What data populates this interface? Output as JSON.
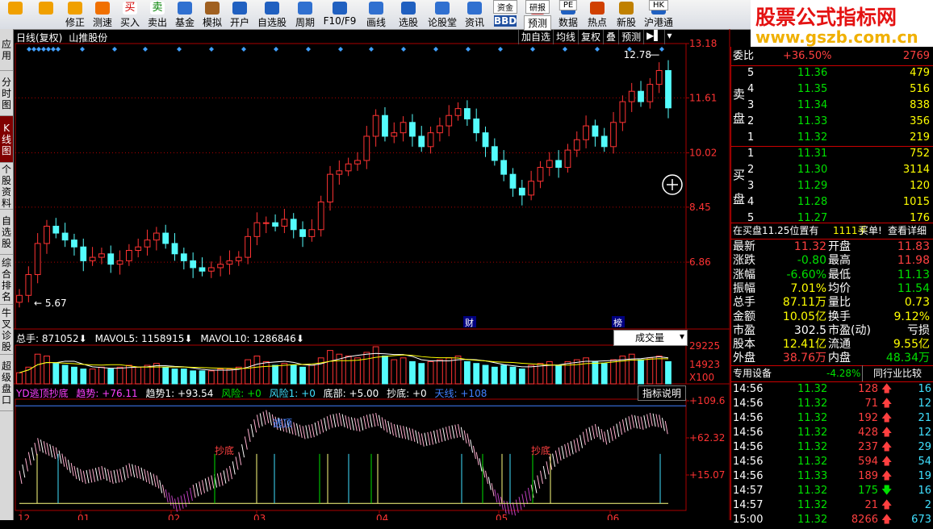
{
  "toolbar": {
    "items": [
      {
        "label": "",
        "icon": "left-arrow-icon"
      },
      {
        "label": "",
        "icon": "right-arrow-icon"
      },
      {
        "label": "修正",
        "icon": "undo-icon"
      },
      {
        "label": "测速",
        "icon": "clock-icon"
      },
      {
        "label": "买入",
        "icon": "buy-icon",
        "glyph": "买"
      },
      {
        "label": "卖出",
        "icon": "sell-icon",
        "glyph": "卖"
      },
      {
        "label": "基金",
        "icon": "fund-icon"
      },
      {
        "label": "模拟",
        "icon": "simulate-icon"
      },
      {
        "label": "开户",
        "icon": "account-icon"
      },
      {
        "label": "自选股",
        "icon": "star-icon"
      },
      {
        "label": "周期",
        "icon": "calendar-icon"
      },
      {
        "label": "F10/F9",
        "icon": "f10-icon"
      },
      {
        "label": "画线",
        "icon": "pen-icon"
      },
      {
        "label": "选股",
        "icon": "filter-icon"
      },
      {
        "label": "论股堂",
        "icon": "forum-icon"
      },
      {
        "label": "资讯",
        "icon": "news-icon"
      },
      {
        "label": "BBD",
        "icon": "bbd-icon",
        "top": "资金"
      },
      {
        "label": "预测",
        "icon": "forecast-icon",
        "top": "研报"
      },
      {
        "label": "数据",
        "icon": "data-icon",
        "top": "PE"
      },
      {
        "label": "热点",
        "icon": "hot-icon"
      },
      {
        "label": "新股",
        "icon": "ipo-icon"
      },
      {
        "label": "沪港通",
        "icon": "hk-icon",
        "top": "HK"
      }
    ]
  },
  "logo": {
    "line1": "股票公式指标网",
    "line2": "www.gszb.com.cn"
  },
  "left_tabs": [
    {
      "label": "应用",
      "active": false
    },
    {
      "label": "分时图",
      "active": false
    },
    {
      "label": "K线图",
      "active": true
    },
    {
      "label": "个股资料",
      "active": false
    },
    {
      "label": "自选股",
      "active": false
    },
    {
      "label": "综合排名",
      "active": false
    },
    {
      "label": "牛叉诊股",
      "active": false
    },
    {
      "label": "超级盘口",
      "active": false
    }
  ],
  "chart_header": {
    "mode": "日线(复权)",
    "stock": "山推股份"
  },
  "chart_buttons": [
    "加自选",
    "均线",
    "复权",
    "叠",
    "预测",
    "▶▌",
    "▾"
  ],
  "price_labels": [
    "13.18",
    "11.61",
    "10.02",
    "8.45",
    "6.86"
  ],
  "high_label": "12.78",
  "low_label": "5.67",
  "event_labels": [
    {
      "text": "财"
    },
    {
      "text": "榜"
    }
  ],
  "volume_header": {
    "total": "总手: 871052",
    "ma5": "MAVOL5: 1158915",
    "ma10": "MAVOL10: 1286846",
    "selector": "成交量"
  },
  "volume_labels": [
    "29225",
    "14923",
    "X100"
  ],
  "indicator_header": {
    "name": "YD逃顶抄底",
    "trend": "趋势: +76.11",
    "trend1": "趋势1: +93.54",
    "risk": "风险: +0",
    "risk1": "风险1: +0",
    "bottom": "底部: +5.00",
    "chaodi": "抄底: +0",
    "tianxian": "天线: +108",
    "help": "指标说明"
  },
  "indicator_labels": [
    "+109.6",
    "+62.32",
    "+15.07"
  ],
  "indicator_marks": [
    {
      "text": "逃顶"
    },
    {
      "text": "抄底"
    },
    {
      "text": "抄底"
    }
  ],
  "date_labels": [
    "12",
    "01",
    "02",
    "03",
    "04",
    "05",
    "06"
  ],
  "right_panel": {
    "weibi": {
      "label": "委比",
      "pct": "+36.50%",
      "value": "2769"
    },
    "sell_label": "卖盘",
    "buy_label": "买盘",
    "sell": [
      {
        "n": "5",
        "price": "11.36",
        "vol": "479"
      },
      {
        "n": "4",
        "price": "11.35",
        "vol": "516"
      },
      {
        "n": "3",
        "price": "11.34",
        "vol": "838"
      },
      {
        "n": "2",
        "price": "11.33",
        "vol": "356"
      },
      {
        "n": "1",
        "price": "11.32",
        "vol": "219"
      }
    ],
    "buy": [
      {
        "n": "1",
        "price": "11.31",
        "vol": "752"
      },
      {
        "n": "2",
        "price": "11.30",
        "vol": "3114"
      },
      {
        "n": "3",
        "price": "11.29",
        "vol": "120"
      },
      {
        "n": "4",
        "price": "11.28",
        "vol": "1015"
      },
      {
        "n": "5",
        "price": "11.27",
        "vol": "176"
      }
    ],
    "notice": {
      "text": "在买盘11.25位置有",
      "vol": "1111手",
      "action": "买单!",
      "detail": "查看详细"
    },
    "stats": [
      {
        "l1": "最新",
        "v1": "11.32",
        "c1": "red",
        "l2": "开盘",
        "v2": "11.83",
        "c2": "red"
      },
      {
        "l1": "涨跌",
        "v1": "-0.80",
        "c1": "green",
        "l2": "最高",
        "v2": "11.98",
        "c2": "red"
      },
      {
        "l1": "涨幅",
        "v1": "-6.60%",
        "c1": "green",
        "l2": "最低",
        "v2": "11.13",
        "c2": "green"
      },
      {
        "l1": "振幅",
        "v1": "7.01%",
        "c1": "yel",
        "l2": "均价",
        "v2": "11.54",
        "c2": "green"
      },
      {
        "l1": "总手",
        "v1": "87.11万",
        "c1": "yel",
        "l2": "量比",
        "v2": "0.73",
        "c2": "yel"
      },
      {
        "l1": "金额",
        "v1": "10.05亿",
        "c1": "yel",
        "l2": "换手",
        "v2": "9.12%",
        "c2": "yel"
      },
      {
        "l1": "市盈",
        "v1": "302.5",
        "c1": "wht",
        "l2": "市盈(动)",
        "v2": "亏损",
        "c2": "wht"
      },
      {
        "l1": "股本",
        "v1": "12.41亿",
        "c1": "yel",
        "l2": "流通",
        "v2": "9.55亿",
        "c2": "yel"
      },
      {
        "l1": "外盘",
        "v1": "38.76万",
        "c1": "red",
        "l2": "内盘",
        "v2": "48.34万",
        "c2": "green"
      }
    ],
    "sector": {
      "name": "专用设备",
      "pct": "-4.28%",
      "compare": "同行业比较"
    },
    "ticks": [
      {
        "time": "14:56",
        "price": "11.32",
        "vol": "128",
        "dir": "up",
        "n": "16"
      },
      {
        "time": "14:56",
        "price": "11.32",
        "vol": "71",
        "dir": "up",
        "n": "12"
      },
      {
        "time": "14:56",
        "price": "11.32",
        "vol": "192",
        "dir": "up",
        "n": "21"
      },
      {
        "time": "14:56",
        "price": "11.32",
        "vol": "428",
        "dir": "up",
        "n": "12"
      },
      {
        "time": "14:56",
        "price": "11.32",
        "vol": "237",
        "dir": "up",
        "n": "29"
      },
      {
        "time": "14:56",
        "price": "11.32",
        "vol": "594",
        "dir": "up",
        "n": "54"
      },
      {
        "time": "14:56",
        "price": "11.33",
        "vol": "189",
        "dir": "up",
        "n": "19"
      },
      {
        "time": "14:57",
        "price": "11.32",
        "vol": "175",
        "dir": "down",
        "n": "16"
      },
      {
        "time": "14:57",
        "price": "11.32",
        "vol": "21",
        "dir": "up",
        "n": "2"
      },
      {
        "time": "15:00",
        "price": "11.32",
        "vol": "8266",
        "dir": "up",
        "n": "673"
      }
    ]
  },
  "colors": {
    "up": "#ff3333",
    "down": "#54fcfc",
    "axis": "#aa0000",
    "ma5": "#ffffff",
    "ma10": "#ffff00"
  },
  "chart_data": {
    "type": "candlestick",
    "title": "山推股份 日线(复权)",
    "ylim": [
      5.3,
      13.18
    ],
    "dates": [
      "12",
      "01",
      "02",
      "03",
      "04",
      "05",
      "06"
    ],
    "close": [
      5.9,
      6.5,
      7.4,
      7.9,
      7.7,
      7.5,
      7.3,
      6.9,
      7.0,
      7.1,
      6.8,
      6.9,
      7.2,
      7.3,
      7.5,
      7.7,
      7.4,
      7.1,
      6.9,
      6.7,
      6.6,
      6.7,
      6.8,
      6.9,
      7.0,
      7.6,
      8.0,
      8.0,
      7.9,
      8.1,
      7.8,
      7.6,
      7.8,
      8.6,
      9.4,
      9.5,
      9.7,
      9.8,
      10.5,
      11.1,
      10.5,
      10.6,
      10.9,
      10.5,
      10.2,
      10.6,
      10.8,
      11.1,
      11.3,
      11.0,
      10.6,
      10.2,
      9.8,
      9.4,
      9.0,
      8.8,
      9.2,
      9.6,
      9.8,
      9.6,
      10.1,
      10.4,
      10.8,
      10.5,
      10.2,
      10.9,
      11.5,
      11.8,
      11.5,
      12.0,
      12.4,
      11.32
    ],
    "volume": [
      6,
      9,
      16,
      15,
      11,
      10,
      9,
      8,
      8,
      9,
      8,
      9,
      10,
      9,
      10,
      11,
      9,
      8,
      8,
      7,
      7,
      7,
      8,
      8,
      9,
      13,
      15,
      12,
      10,
      11,
      10,
      9,
      10,
      14,
      18,
      16,
      15,
      14,
      17,
      20,
      15,
      13,
      14,
      12,
      11,
      12,
      13,
      14,
      15,
      12,
      11,
      10,
      9,
      10,
      9,
      8,
      10,
      11,
      12,
      10,
      12,
      13,
      14,
      12,
      11,
      13,
      15,
      16,
      13,
      14,
      15,
      12
    ],
    "indicator": [
      40,
      60,
      75,
      70,
      65,
      55,
      45,
      40,
      42,
      45,
      40,
      42,
      48,
      45,
      40,
      35,
      20,
      10,
      15,
      25,
      30,
      35,
      38,
      45,
      60,
      85,
      100,
      105,
      98,
      95,
      92,
      88,
      90,
      95,
      100,
      102,
      98,
      96,
      100,
      102,
      95,
      90,
      88,
      85,
      80,
      82,
      85,
      88,
      90,
      80,
      60,
      40,
      20,
      8,
      6,
      15,
      25,
      40,
      55,
      65,
      70,
      75,
      85,
      90,
      82,
      88,
      95,
      100,
      98,
      102,
      100,
      90
    ],
    "indicator_ylim": [
      0,
      115
    ],
    "indicator_levels": [
      109.6,
      62.32,
      15.07
    ]
  }
}
